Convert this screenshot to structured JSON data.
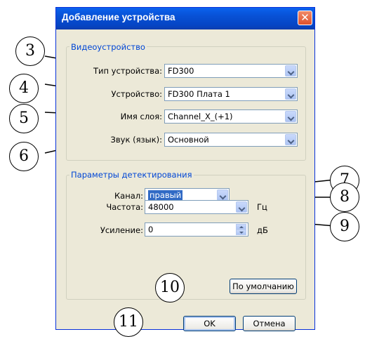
{
  "dialog": {
    "title": "Добавление устройства",
    "close_glyph": "✕"
  },
  "video_group": {
    "legend": "Видеоустройство",
    "device_type": {
      "label": "Тип устройства:",
      "value": "FD300"
    },
    "device": {
      "label": "Устройство:",
      "value": "FD300 Плата 1"
    },
    "layer_name": {
      "label": "Имя слоя:",
      "value": "Channel_X_(+1)"
    },
    "sound": {
      "label": "Звук (язык):",
      "value": "Основной"
    }
  },
  "detect_group": {
    "legend": "Параметры детектирования",
    "channel": {
      "label": "Канал:",
      "value": "правый"
    },
    "frequency": {
      "label": "Частота:",
      "value": "48000",
      "unit": "Гц"
    },
    "gain": {
      "label": "Усиление:",
      "value": "0",
      "unit": "дБ"
    },
    "default_button": "По умолчанию"
  },
  "buttons": {
    "ok": "OK",
    "cancel": "Отмена"
  },
  "callouts": [
    "3",
    "4",
    "5",
    "6",
    "7",
    "8",
    "9",
    "10",
    "11"
  ]
}
